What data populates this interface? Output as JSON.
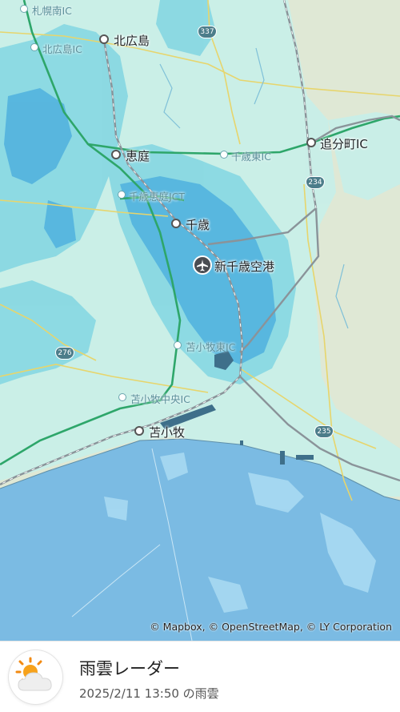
{
  "map": {
    "cities": [
      {
        "name": "北広島"
      },
      {
        "name": "恵庭"
      },
      {
        "name": "千歳"
      },
      {
        "name": "苫小牧"
      }
    ],
    "interchanges": [
      {
        "name": "札幌南IC"
      },
      {
        "name": "北広島IC"
      },
      {
        "name": "千歳東IC"
      },
      {
        "name": "千歳恵庭JCT"
      },
      {
        "name": "苫小牧東IC"
      },
      {
        "name": "苫小牧中央IC"
      },
      {
        "name": "追分町IC"
      }
    ],
    "airport": {
      "name": "新千歳空港",
      "icon": "airplane-icon"
    },
    "route_shields": [
      "337",
      "234",
      "276",
      "235"
    ],
    "attribution": "© Mapbox, © OpenStreetMap, © LY Corporation",
    "colors": {
      "land": "#dfe8d5",
      "rain_light": "#c9f0ea",
      "rain_medium": "#77d0e0",
      "rain_heavy": "#4aa7dd",
      "sea": "#7bbbe3",
      "highway": "#2ea66a",
      "railway": "#8a9399"
    }
  },
  "footer": {
    "title": "雨雲レーダー",
    "subtitle": "2025/2/11 13:50 の雨雲",
    "logo_icon": "sun-behind-cloud-icon"
  }
}
